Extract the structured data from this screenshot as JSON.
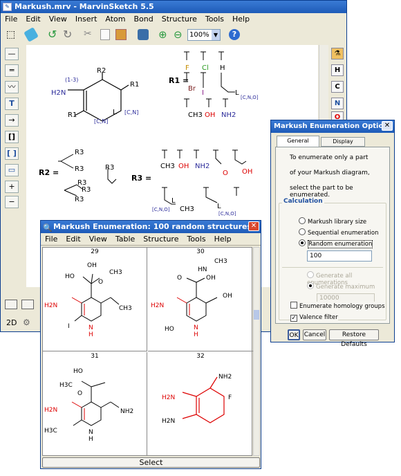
{
  "main_window": {
    "title": "Markush.mrv - MarvinSketch 5.5",
    "menu": [
      "File",
      "Edit",
      "View",
      "Insert",
      "Atom",
      "Bond",
      "Structure",
      "Tools",
      "Help"
    ],
    "zoom": "100%",
    "status_zoom": "2D",
    "right_buttons": [
      "H",
      "C",
      "N",
      "O"
    ],
    "canvas": {
      "r1_label": "R1 =",
      "r2_label": "R2 =",
      "r3_label": "R3 =",
      "core_labels": [
        "R2",
        "R1",
        "R1",
        "H2N",
        "(1-3)",
        "L",
        "[C,N]",
        "[C,N]"
      ],
      "r1_options": [
        "F",
        "Cl",
        "H",
        "Br",
        "I",
        "L",
        "CH3",
        "OH",
        "NH2",
        "[C,N,O]"
      ],
      "r2_labels": [
        "R3",
        "R3",
        "R3",
        "R3",
        "R3",
        "R3"
      ],
      "r3_options": [
        "CH3",
        "OH",
        "NH2",
        "O",
        "OH",
        "[C,N,O]",
        "L",
        "CH3",
        "L",
        "[C,N,O]"
      ]
    }
  },
  "enum_window": {
    "title": "Markush Enumeration: 100 random structures",
    "menu": [
      "File",
      "Edit",
      "View",
      "Table",
      "Structure",
      "Tools",
      "Help"
    ],
    "cells": [
      {
        "id": "29",
        "labels": [
          "OH",
          "HO",
          "O",
          "CH3",
          "CH3",
          "H2N",
          "I",
          "N",
          "H"
        ]
      },
      {
        "id": "30",
        "labels": [
          "HN",
          "CH3",
          "O",
          "OH",
          "OH",
          "H2N",
          "HO",
          "N",
          "H"
        ]
      },
      {
        "id": "31",
        "labels": [
          "HO",
          "H3C",
          "O",
          "H2N",
          "H3C",
          "NH2",
          "N",
          "H"
        ]
      },
      {
        "id": "32",
        "labels": [
          "NH2",
          "F",
          "H2N",
          "H2N"
        ]
      }
    ],
    "select_label": "Select"
  },
  "options_dialog": {
    "title": "Markush Enumeration Options",
    "tabs": [
      "General Options",
      "Display Options"
    ],
    "info_lines": [
      "To enumerate only a part",
      "of your Markush diagram,",
      "select the part to be enumerated."
    ],
    "calc_group": "Calculation",
    "radios": [
      {
        "label": "Markush library size",
        "checked": false
      },
      {
        "label": "Sequential enumeration",
        "checked": false
      },
      {
        "label": "Random enumeration",
        "checked": true
      }
    ],
    "random_count": "100",
    "disabled_radios": [
      "Generate all enumerations",
      "Generate maximum"
    ],
    "max_value": "10000",
    "checkboxes": [
      {
        "label": "Enumerate homology groups",
        "checked": false
      },
      {
        "label": "Valence filter",
        "checked": true
      }
    ],
    "buttons": [
      "OK",
      "Cancel",
      "Restore Defaults"
    ]
  }
}
